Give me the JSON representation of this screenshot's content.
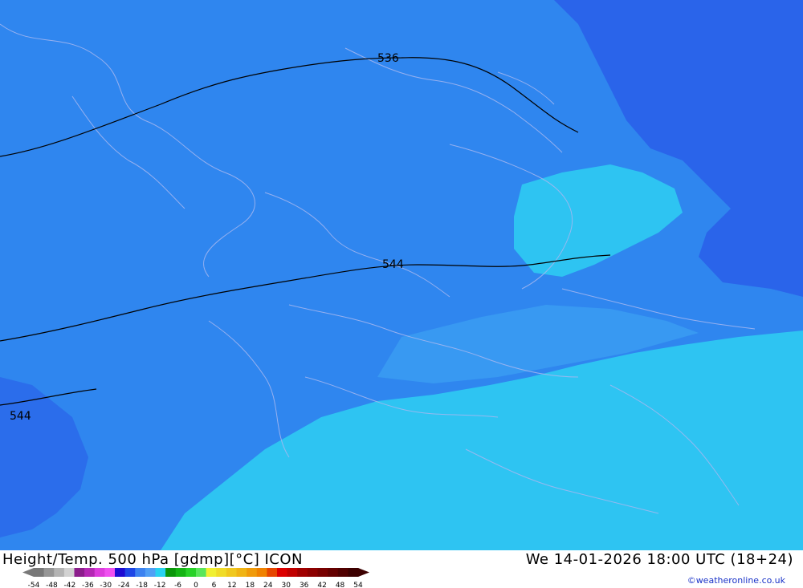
{
  "title": "Height/Temp. 500 hPa [gdmp][°C] ICON",
  "valid_time": "We 14-01-2026 18:00 UTC (18+24)",
  "credit": "©weatheronline.co.uk",
  "height_labels": [
    "536",
    "544",
    "544"
  ],
  "colorbar": {
    "ticks": [
      "-54",
      "-48",
      "-42",
      "-36",
      "-30",
      "-24",
      "-18",
      "-12",
      "-6",
      "0",
      "6",
      "12",
      "18",
      "24",
      "30",
      "36",
      "42",
      "48",
      "54"
    ],
    "colors": [
      "#787878",
      "#969696",
      "#b4b4b4",
      "#d2d2d2",
      "#8c1e8c",
      "#b428b4",
      "#dc3cdc",
      "#f050f0",
      "#1e0ad2",
      "#1e46e6",
      "#3c82f0",
      "#50a0f5",
      "#28d2f0",
      "#0a960a",
      "#14b414",
      "#28d228",
      "#5ae65a",
      "#f0f032",
      "#f0dc28",
      "#f0c81e",
      "#f0b414",
      "#f09b0a",
      "#f08200",
      "#e64600",
      "#dc0000",
      "#c00000",
      "#a00000",
      "#8c0000",
      "#780000",
      "#640000",
      "#500000",
      "#3c0000"
    ]
  },
  "colors": {
    "field_blue": "#2f86ef",
    "field_deep": "#2a64ea",
    "field_cyan": "#2ec4f2",
    "field_light": "#40b4f3",
    "contour": "#000000",
    "border": "#a8b8f0"
  }
}
